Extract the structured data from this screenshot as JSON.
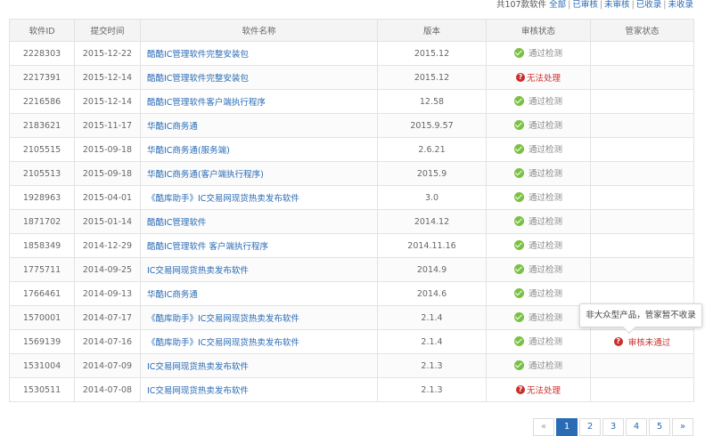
{
  "filter": {
    "total": "共107款软件",
    "links": [
      "全部",
      "已审核",
      "未审核",
      "已收录",
      "未收录"
    ]
  },
  "columns": [
    "软件ID",
    "提交时间",
    "软件名称",
    "版本",
    "审核状态",
    "管家状态"
  ],
  "rows": [
    {
      "id": "2228303",
      "date": "2015-12-22",
      "name": "酷酷IC管理软件完整安装包",
      "version": "2015.12",
      "review": "ok",
      "review_text": "通过检测",
      "manager": ""
    },
    {
      "id": "2217391",
      "date": "2015-12-14",
      "name": "酷酷IC管理软件完整安装包",
      "version": "2015.12",
      "review": "error",
      "review_text": "无法处理",
      "manager": ""
    },
    {
      "id": "2216586",
      "date": "2015-12-14",
      "name": "酷酷IC管理软件客户端执行程序",
      "version": "12.58",
      "review": "ok",
      "review_text": "通过检测",
      "manager": ""
    },
    {
      "id": "2183621",
      "date": "2015-11-17",
      "name": "华酷IC商务通",
      "version": "2015.9.57",
      "review": "ok",
      "review_text": "通过检测",
      "manager": ""
    },
    {
      "id": "2105515",
      "date": "2015-09-18",
      "name": "华酷IC商务通(服务端)",
      "version": "2.6.21",
      "review": "ok",
      "review_text": "通过检测",
      "manager": ""
    },
    {
      "id": "2105513",
      "date": "2015-09-18",
      "name": "华酷IC商务通(客户端执行程序)",
      "version": "2015.9",
      "review": "ok",
      "review_text": "通过检测",
      "manager": ""
    },
    {
      "id": "1928963",
      "date": "2015-04-01",
      "name": "《酷库助手》IC交易网现货热卖发布软件",
      "version": "3.0",
      "review": "ok",
      "review_text": "通过检测",
      "manager": ""
    },
    {
      "id": "1871702",
      "date": "2015-01-14",
      "name": "酷酷IC管理软件",
      "version": "2014.12",
      "review": "ok",
      "review_text": "通过检测",
      "manager": ""
    },
    {
      "id": "1858349",
      "date": "2014-12-29",
      "name": "酷酷IC管理软件 客户端执行程序",
      "version": "2014.11.16",
      "review": "ok",
      "review_text": "通过检测",
      "manager": ""
    },
    {
      "id": "1775711",
      "date": "2014-09-25",
      "name": "IC交易网现货热卖发布软件",
      "version": "2014.9",
      "review": "ok",
      "review_text": "通过检测",
      "manager": ""
    },
    {
      "id": "1766461",
      "date": "2014-09-13",
      "name": "华酷IC商务通",
      "version": "2014.6",
      "review": "ok",
      "review_text": "通过检测",
      "manager": ""
    },
    {
      "id": "1570001",
      "date": "2014-07-17",
      "name": "《酷库助手》IC交易网现货热卖发布软件",
      "version": "2.1.4",
      "review": "ok",
      "review_text": "通过检测",
      "manager": ""
    },
    {
      "id": "1569139",
      "date": "2014-07-16",
      "name": "《酷库助手》IC交易网现货热卖发布软件",
      "version": "2.1.4",
      "review": "ok",
      "review_text": "通过检测",
      "manager": "审核未通过"
    },
    {
      "id": "1531004",
      "date": "2014-07-09",
      "name": "IC交易网现货热卖发布软件",
      "version": "2.1.3",
      "review": "ok",
      "review_text": "通过检测",
      "manager": ""
    },
    {
      "id": "1530511",
      "date": "2014-07-08",
      "name": "IC交易网现货热卖发布软件",
      "version": "2.1.3",
      "review": "error",
      "review_text": "无法处理",
      "manager": ""
    }
  ],
  "tooltip": "非大众型产品，管家暂不收录",
  "pagination": {
    "prev": "«",
    "pages": [
      "1",
      "2",
      "3",
      "4",
      "5"
    ],
    "active": "1",
    "next": "»"
  },
  "colors": {
    "link": "#2a6bb5",
    "ok": "#7ac143",
    "error": "#c9302c"
  },
  "icons": {
    "ok": "check-circle-icon",
    "error": "question-circle-icon"
  }
}
